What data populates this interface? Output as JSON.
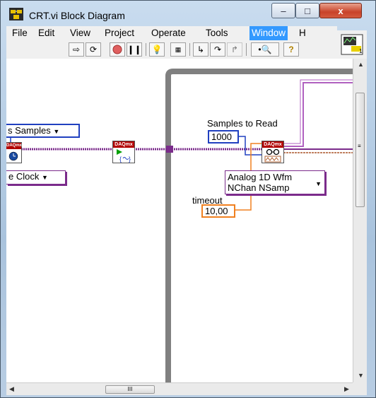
{
  "window": {
    "title": "CRT.vi Block Diagram",
    "minimize_label": "–",
    "maximize_label": "□",
    "close_label": "x"
  },
  "menu": {
    "items": [
      "File",
      "Edit",
      "View",
      "Project",
      "Operate",
      "Tools",
      "Window",
      "H"
    ],
    "active": "Window"
  },
  "toolbar": {
    "buttons": [
      "run-arrow",
      "run-continuously",
      "abort",
      "pause",
      "highlight-execution",
      "retain-wire-values",
      "step-into",
      "step-over",
      "step-out",
      "zoom-search",
      "help"
    ]
  },
  "diagram": {
    "samples_enum_label": "s Samples",
    "sample_clock_label": "e Clock",
    "samples_to_read_label": "Samples to Read",
    "samples_to_read_value": "1000",
    "read_mode_line1": "Analog 1D Wfm",
    "read_mode_line2": "NChan NSamp",
    "timeout_label": "timeout",
    "timeout_value": "10,00",
    "daq_tag": "DAQmx"
  },
  "scrollbar": {
    "h_grip": "III"
  },
  "colors": {
    "task_wire": "#7b2b8b",
    "numeric_int": "#2040c0",
    "numeric_dbl": "#f08020",
    "error_wire": "#c0a060",
    "loop_frame": "#808080"
  }
}
